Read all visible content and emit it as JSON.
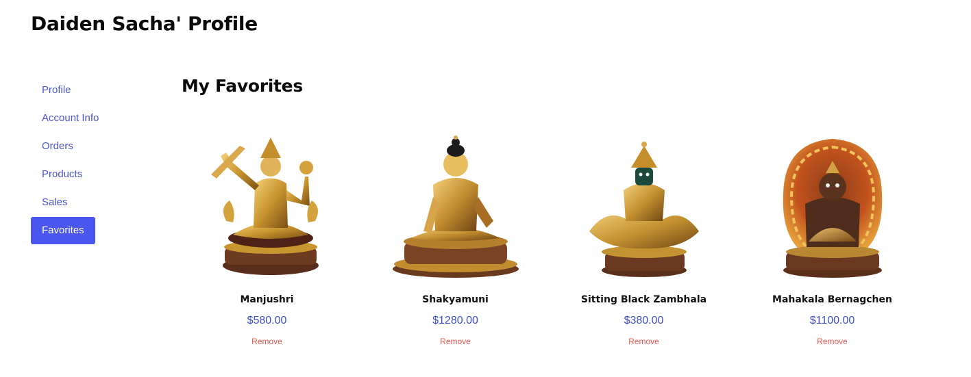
{
  "header": {
    "title": "Daiden Sacha' Profile"
  },
  "sidebar": {
    "items": [
      {
        "label": "Profile"
      },
      {
        "label": "Account Info"
      },
      {
        "label": "Orders"
      },
      {
        "label": "Products"
      },
      {
        "label": "Sales"
      },
      {
        "label": "Favorites",
        "active": true
      }
    ]
  },
  "main": {
    "title": "My Favorites",
    "favorites": [
      {
        "name": "Manjushri",
        "price": "$580.00",
        "remove_label": "Remove",
        "icon": "statue-image"
      },
      {
        "name": "Shakyamuni",
        "price": "$1280.00",
        "remove_label": "Remove",
        "icon": "statue-image"
      },
      {
        "name": "Sitting Black Zambhala",
        "price": "$380.00",
        "remove_label": "Remove",
        "icon": "statue-image"
      },
      {
        "name": "Mahakala Bernagchen",
        "price": "$1100.00",
        "remove_label": "Remove",
        "icon": "statue-image"
      }
    ]
  },
  "colors": {
    "accent": "#4b56ef",
    "link": "#4a55c9",
    "price": "#3f4fc3",
    "remove": "#e0554f"
  }
}
